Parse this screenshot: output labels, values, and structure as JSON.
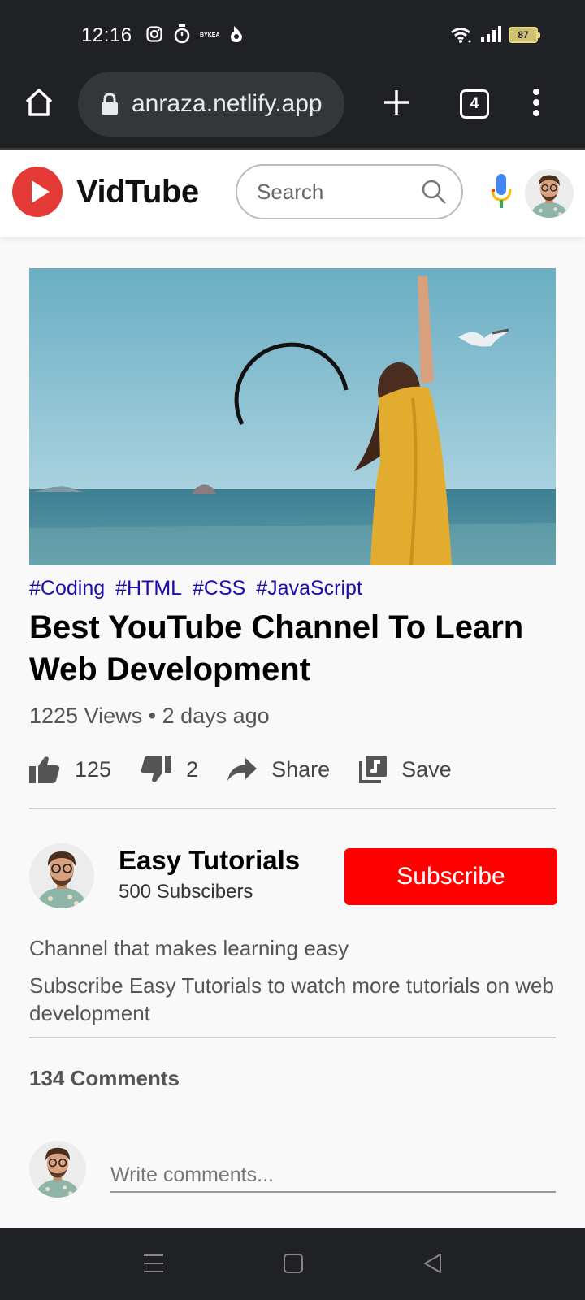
{
  "status_bar": {
    "time": "12:16",
    "notification_icons": [
      "instagram-icon",
      "timer-icon",
      "bykea-icon",
      "app-icon"
    ],
    "bykea_label": "BYKEA",
    "battery_level": "87"
  },
  "browser": {
    "url": "anraza.netlify.app",
    "tab_count": "4"
  },
  "site": {
    "logo_text": "VidTube",
    "search_placeholder": "Search"
  },
  "video": {
    "tags": [
      "#Coding",
      "#HTML",
      "#CSS",
      "#JavaScript"
    ],
    "title": "Best YouTube Channel To Learn Web Development",
    "views": "1225 Views",
    "separator": "•",
    "age": "2 days ago",
    "actions": {
      "likes": "125",
      "dislikes": "2",
      "share_label": "Share",
      "save_label": "Save"
    }
  },
  "channel": {
    "name": "Easy Tutorials",
    "subscribers": "500 Subscibers",
    "subscribe_label": "Subscribe",
    "description_1": "Channel that makes learning easy",
    "description_2": "Subscribe Easy Tutorials to watch more tutorials on web development"
  },
  "comments": {
    "count_label": "134 Comments",
    "input_placeholder": "Write comments..."
  },
  "colors": {
    "brand_red": "#ff0000",
    "tag_blue": "#1a0dab",
    "chrome_dark": "#202124"
  }
}
